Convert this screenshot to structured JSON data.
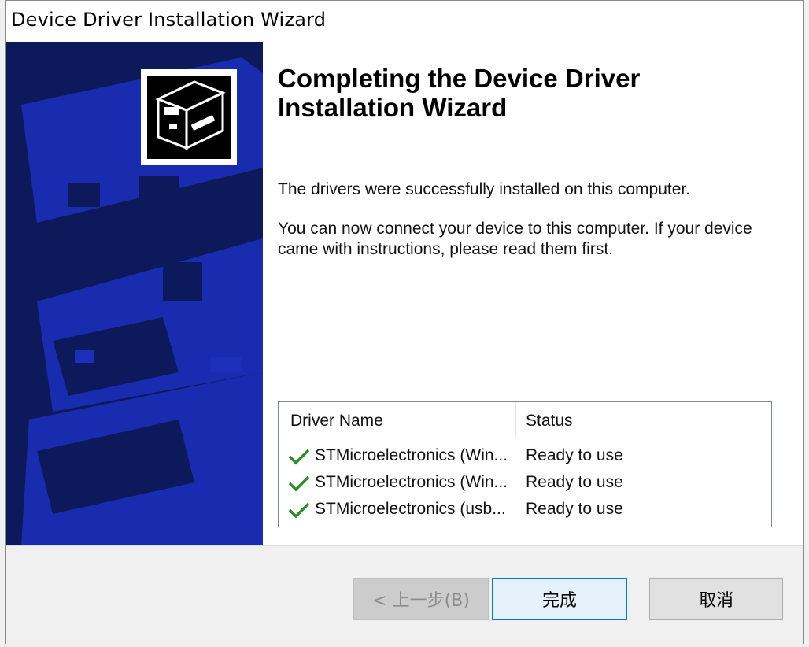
{
  "window": {
    "title": "Device Driver Installation Wizard"
  },
  "heading": "Completing the Device Driver Installation Wizard",
  "messages": {
    "success": "The drivers were successfully installed on this computer.",
    "instructions": "You can now connect your device to this computer. If your device came with instructions, please read them first."
  },
  "driver_table": {
    "columns": [
      "Driver Name",
      "Status"
    ],
    "rows": [
      {
        "name": "STMicroelectronics (Win...",
        "status": "Ready to use",
        "icon": "green-check-icon"
      },
      {
        "name": "STMicroelectronics (Win...",
        "status": "Ready to use",
        "icon": "green-check-icon"
      },
      {
        "name": "STMicroelectronics (usb...",
        "status": "Ready to use",
        "icon": "green-check-icon"
      }
    ]
  },
  "buttons": {
    "back": "< 上一步(B)",
    "finish": "完成",
    "cancel": "取消"
  },
  "colors": {
    "side_panel": "#0c1a5c",
    "check": "#2e8b2e",
    "focus_border": "#0078d7"
  }
}
